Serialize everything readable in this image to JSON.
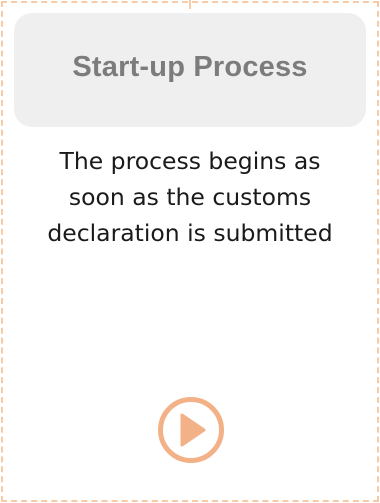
{
  "card": {
    "title": "Start-up Process",
    "description": "The process begins as soon as the customs declaration is submitted"
  },
  "play_button": {
    "icon": "play-icon",
    "color": "#f2b186"
  },
  "colors": {
    "border": "#f6cba6",
    "title_bg": "#efefef",
    "title_text": "#7c7c7c",
    "body_text": "#1a1a1a"
  }
}
